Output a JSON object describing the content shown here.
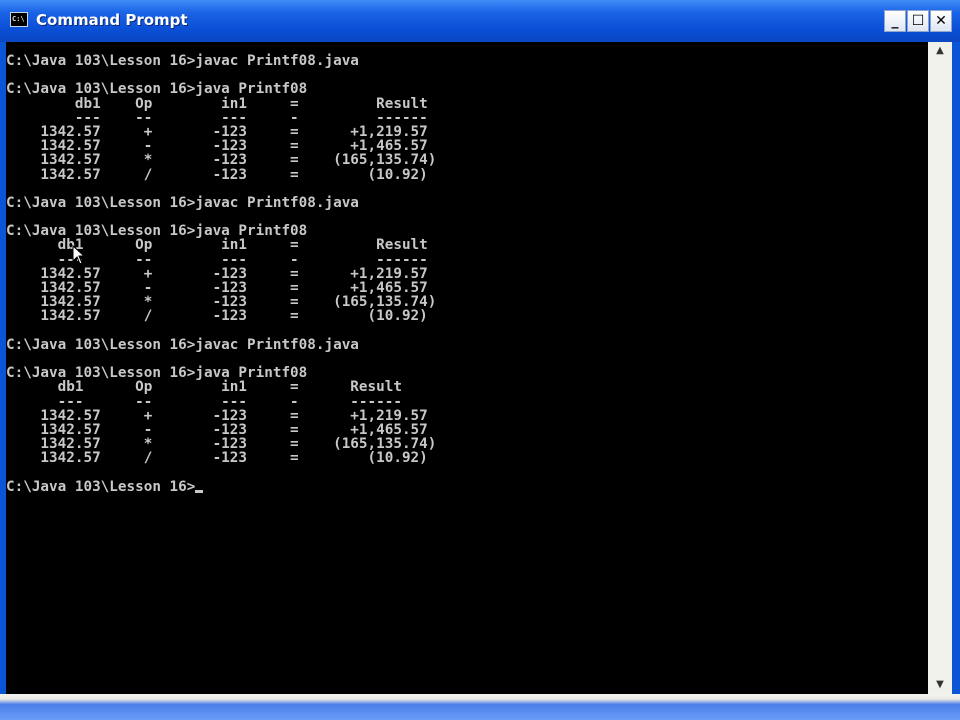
{
  "window": {
    "title": "Command Prompt",
    "icon_label": "C:\\",
    "controls": {
      "minimize": "_",
      "maximize": "☐",
      "close": "✕"
    }
  },
  "console": {
    "lines": [
      "C:\\Java 103\\Lesson 16>javac Printf08.java",
      "",
      "C:\\Java 103\\Lesson 16>java Printf08",
      "        db1    Op        in1     =         Result",
      "        ---    --        ---     -         ------",
      "    1342.57     +       -123     =      +1,219.57",
      "    1342.57     -       -123     =      +1,465.57",
      "    1342.57     *       -123     =    (165,135.74)",
      "    1342.57     /       -123     =        (10.92)",
      "",
      "C:\\Java 103\\Lesson 16>javac Printf08.java",
      "",
      "C:\\Java 103\\Lesson 16>java Printf08",
      "      db1      Op        in1     =         Result",
      "      ---      --        ---     -         ------",
      "    1342.57     +       -123     =      +1,219.57",
      "    1342.57     -       -123     =      +1,465.57",
      "    1342.57     *       -123     =    (165,135.74)",
      "    1342.57     /       -123     =        (10.92)",
      "",
      "C:\\Java 103\\Lesson 16>javac Printf08.java",
      "",
      "C:\\Java 103\\Lesson 16>java Printf08",
      "      db1      Op        in1     =      Result",
      "      ---      --        ---     -      ------",
      "    1342.57     +       -123     =      +1,219.57",
      "    1342.57     -       -123     =      +1,465.57",
      "    1342.57     *       -123     =    (165,135.74)",
      "    1342.57     /       -123     =        (10.92)",
      ""
    ],
    "prompt": "C:\\Java 103\\Lesson 16>"
  },
  "scrollbar": {
    "up_arrow": "▲",
    "down_arrow": "▼"
  }
}
